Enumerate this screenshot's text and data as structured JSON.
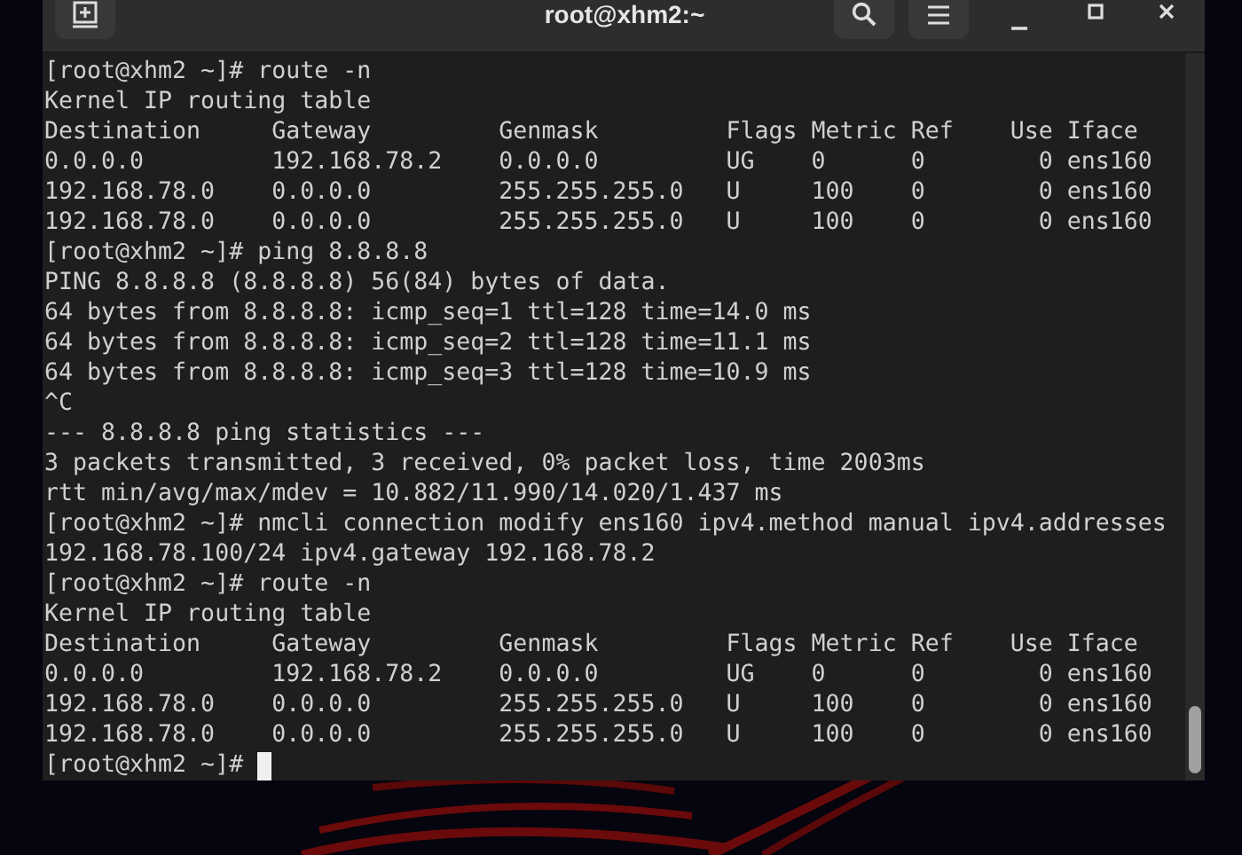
{
  "window": {
    "title": "root@xhm2:~"
  },
  "terminal": {
    "lines": [
      "[root@xhm2 ~]# route -n",
      "Kernel IP routing table",
      "Destination     Gateway         Genmask         Flags Metric Ref    Use Iface",
      "0.0.0.0         192.168.78.2    0.0.0.0         UG    0      0        0 ens160",
      "192.168.78.0    0.0.0.0         255.255.255.0   U     100    0        0 ens160",
      "192.168.78.0    0.0.0.0         255.255.255.0   U     100    0        0 ens160",
      "[root@xhm2 ~]# ping 8.8.8.8",
      "PING 8.8.8.8 (8.8.8.8) 56(84) bytes of data.",
      "64 bytes from 8.8.8.8: icmp_seq=1 ttl=128 time=14.0 ms",
      "64 bytes from 8.8.8.8: icmp_seq=2 ttl=128 time=11.1 ms",
      "64 bytes from 8.8.8.8: icmp_seq=3 ttl=128 time=10.9 ms",
      "^C",
      "--- 8.8.8.8 ping statistics ---",
      "3 packets transmitted, 3 received, 0% packet loss, time 2003ms",
      "rtt min/avg/max/mdev = 10.882/11.990/14.020/1.437 ms",
      "[root@xhm2 ~]# nmcli connection modify ens160 ipv4.method manual ipv4.addresses",
      "192.168.78.100/24 ipv4.gateway 192.168.78.2",
      "[root@xhm2 ~]# route -n",
      "Kernel IP routing table",
      "Destination     Gateway         Genmask         Flags Metric Ref    Use Iface",
      "0.0.0.0         192.168.78.2    0.0.0.0         UG    0      0        0 ens160",
      "192.168.78.0    0.0.0.0         255.255.255.0   U     100    0        0 ens160",
      "192.168.78.0    0.0.0.0         255.255.255.0   U     100    0        0 ens160"
    ],
    "prompt": "[root@xhm2 ~]# "
  }
}
